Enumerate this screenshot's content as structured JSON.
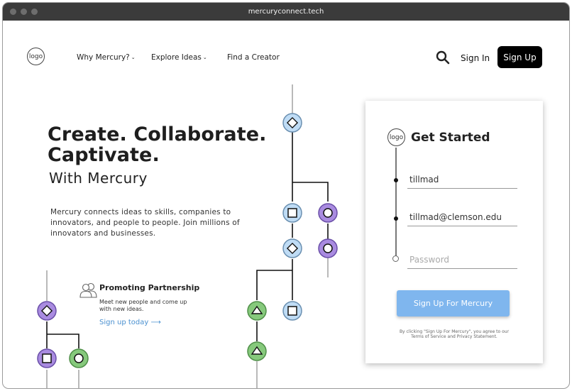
{
  "browser": {
    "url": "mercuryconnect.tech"
  },
  "header": {
    "logo_text": "logo",
    "nav": [
      {
        "label": "Why Mercury?",
        "has_dropdown": true
      },
      {
        "label": "Explore Ideas",
        "has_dropdown": true
      },
      {
        "label": "Find a Creator",
        "has_dropdown": false
      }
    ],
    "search_icon": "search-icon",
    "signin_label": "Sign In",
    "signup_label": "Sign Up"
  },
  "hero": {
    "title_line1": "Create. Collaborate.",
    "title_line2": "Captivate.",
    "subtitle": "With Mercury",
    "description": "Mercury connects ideas to skills, companies to innovators, and people to people. Join millions of innovators and businesses."
  },
  "promo": {
    "icon": "people-icon",
    "title": "Promoting Partnership",
    "description": "Meet new people and come up with new ideas.",
    "link_label": "Sign up today",
    "link_arrow": "⟶"
  },
  "signup_card": {
    "logo_text": "logo",
    "title": "Get Started",
    "username_value": "tillmad",
    "email_value": "tillmad@clemson.edu",
    "password_placeholder": "Password",
    "submit_label": "Sign Up For Mercury",
    "terms": "By clicking \"Sign Up For Mercury\", you agree to our Terms of Service and Privacy Statement."
  },
  "colors": {
    "accent_blue": "#7fb6ee",
    "node_blue": "#bfdcf5",
    "node_purple": "#a98be0",
    "node_green": "#86c97c",
    "link": "#4a90d0"
  }
}
